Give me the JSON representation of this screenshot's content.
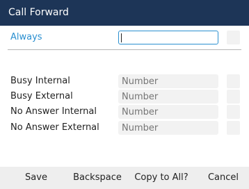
{
  "window": {
    "title": "Call Forward"
  },
  "forwards": {
    "always": {
      "label": "Always",
      "value": ""
    },
    "busy_internal": {
      "label": "Busy Internal",
      "placeholder": "Number"
    },
    "busy_external": {
      "label": "Busy External",
      "placeholder": "Number"
    },
    "no_answer_internal": {
      "label": "No Answer Internal",
      "placeholder": "Number"
    },
    "no_answer_external": {
      "label": "No Answer External",
      "placeholder": "Number"
    }
  },
  "softkeys": {
    "save": "Save",
    "backspace": "Backspace",
    "copy_to_all": "Copy to All?",
    "cancel": "Cancel"
  },
  "colors": {
    "title_bar": "#1d3557",
    "accent": "#2a8fd0",
    "softkey_bar": "#eeeeee",
    "field_bg": "#f2f2f2"
  }
}
